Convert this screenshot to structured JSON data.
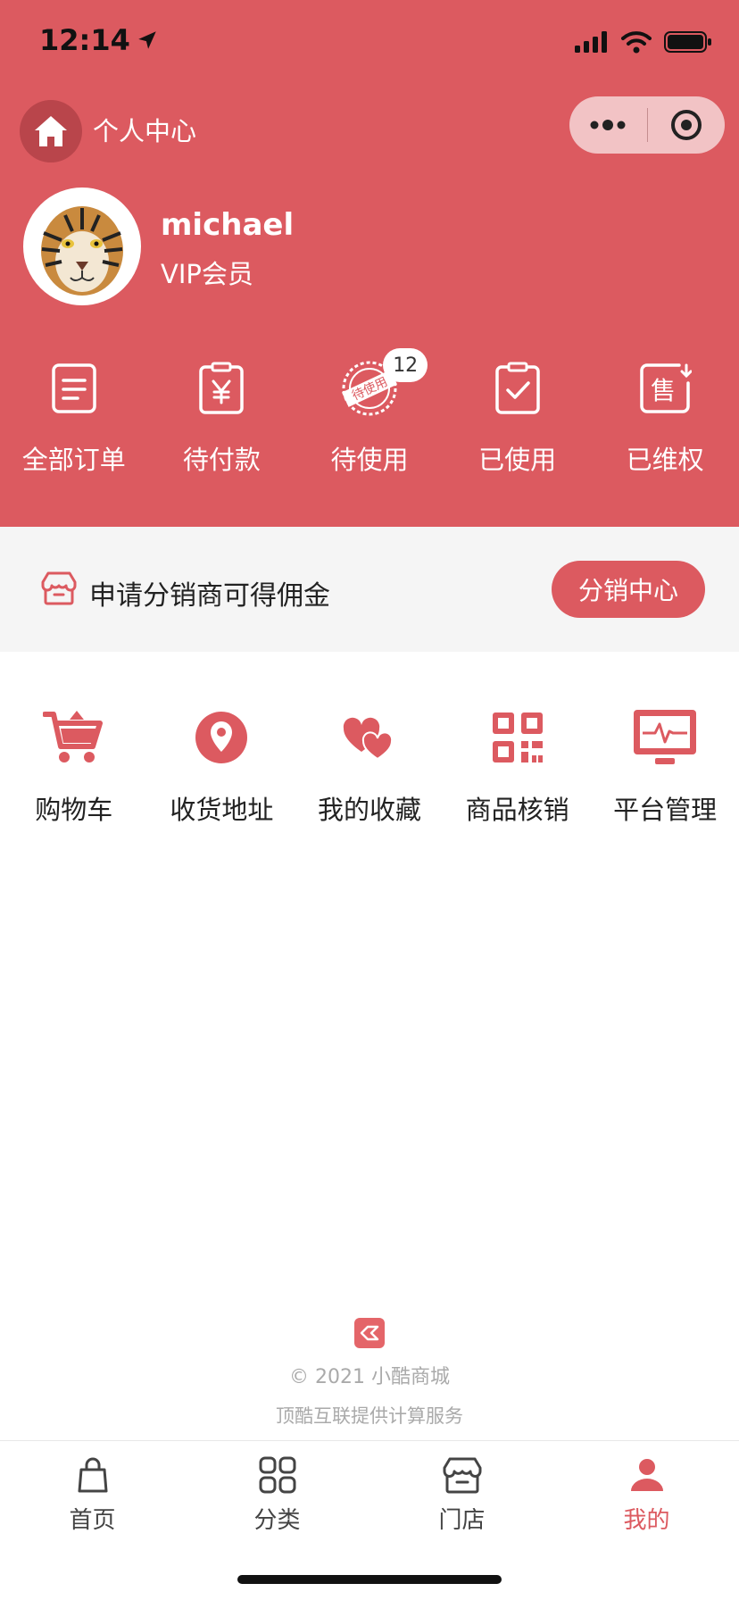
{
  "status_bar": {
    "time": "12:14"
  },
  "nav": {
    "title": "个人中心"
  },
  "profile": {
    "username": "michael",
    "member_level": "VIP会员"
  },
  "orders": [
    {
      "label": "全部订单",
      "icon": "document-list-icon"
    },
    {
      "label": "待付款",
      "icon": "yen-clipboard-icon"
    },
    {
      "label": "待使用",
      "icon": "to-use-stamp-icon",
      "stamp_text": "待使用",
      "badge": "12"
    },
    {
      "label": "已使用",
      "icon": "clipboard-check-icon"
    },
    {
      "label": "已维权",
      "icon": "after-sale-icon",
      "icon_char": "售"
    }
  ],
  "distributor": {
    "text": "申请分销商可得佣金",
    "button": "分销中心"
  },
  "tools": [
    {
      "label": "购物车",
      "icon": "cart-icon"
    },
    {
      "label": "收货地址",
      "icon": "location-pin-icon"
    },
    {
      "label": "我的收藏",
      "icon": "hearts-icon"
    },
    {
      "label": "商品核销",
      "icon": "qr-code-icon"
    },
    {
      "label": "平台管理",
      "icon": "monitor-icon"
    }
  ],
  "footer": {
    "copyright": "© 2021 小酷商城",
    "powered_by": "顶酷互联提供计算服务"
  },
  "tab_bar": [
    {
      "label": "首页",
      "icon": "shopping-bag-icon",
      "active": false
    },
    {
      "label": "分类",
      "icon": "grid-icon",
      "active": false
    },
    {
      "label": "门店",
      "icon": "store-icon",
      "active": false
    },
    {
      "label": "我的",
      "icon": "person-icon",
      "active": true
    }
  ],
  "colors": {
    "brand": "#dc5a60",
    "background_gray": "#f5f5f5",
    "footer_text": "#aaaaaa"
  }
}
